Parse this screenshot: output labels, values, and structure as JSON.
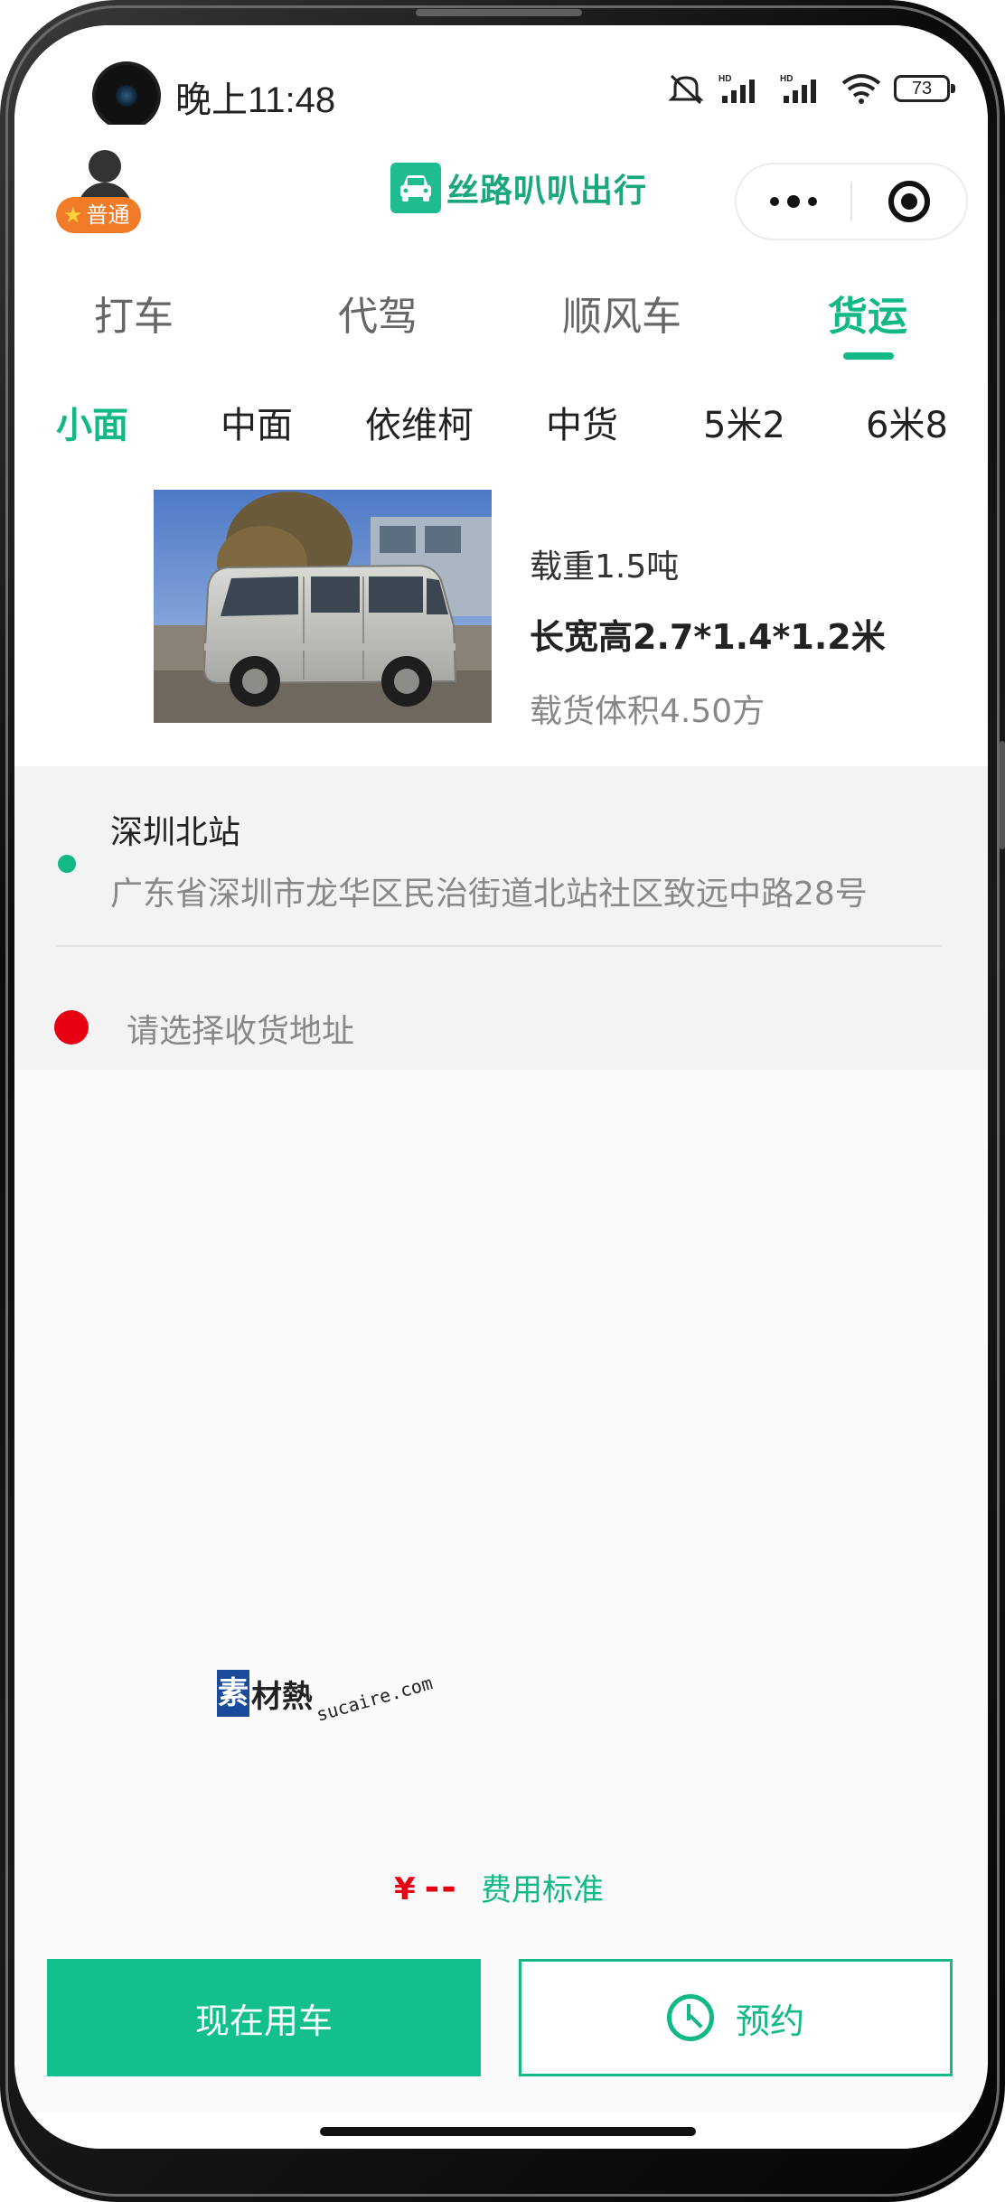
{
  "status_bar": {
    "time": "晚上11:48",
    "battery": "73",
    "icons": [
      "mute-icon",
      "hd-signal-icon",
      "hd-signal-icon",
      "wifi-icon",
      "battery-icon"
    ]
  },
  "header": {
    "member_badge": "普通",
    "app_name": "丝路叭叭出行"
  },
  "main_tabs": [
    {
      "label": "打车",
      "active": false
    },
    {
      "label": "代驾",
      "active": false
    },
    {
      "label": "顺风车",
      "active": false
    },
    {
      "label": "货运",
      "active": true
    }
  ],
  "vehicle_tabs": [
    {
      "label": "小面",
      "active": true
    },
    {
      "label": "中面",
      "active": false
    },
    {
      "label": "依维柯",
      "active": false
    },
    {
      "label": "中货",
      "active": false
    },
    {
      "label": "5米2",
      "active": false
    },
    {
      "label": "6米8",
      "active": false
    }
  ],
  "vehicle": {
    "load": "载重1.5吨",
    "dimensions": "长宽高2.7*1.4*1.2米",
    "volume": "载货体积4.50方"
  },
  "address": {
    "from_title": "深圳北站",
    "from_detail": "广东省深圳市龙华区民治街道北站社区致远中路28号",
    "to_placeholder": "请选择收货地址"
  },
  "watermark": {
    "badge_char": "素",
    "text": "材熱",
    "url": "sucaire.com"
  },
  "price": {
    "currency": "¥",
    "value": "--",
    "fee_link": "费用标准"
  },
  "actions": {
    "now": "现在用车",
    "book": "预约"
  },
  "colors": {
    "accent": "#12b886",
    "price_red": "#e60012",
    "badge_orange": "#f07c2a"
  }
}
